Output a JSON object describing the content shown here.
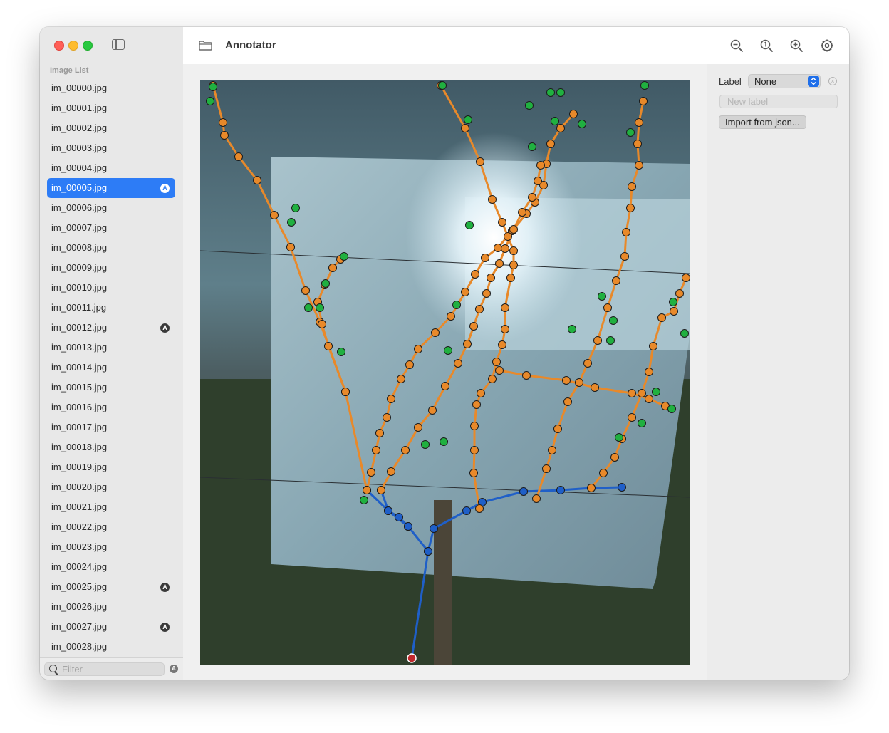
{
  "window": {
    "title": "Annotator"
  },
  "sidebar": {
    "section_header": "Image List",
    "items": [
      {
        "label": "im_00000.jpg",
        "annotated": false,
        "selected": false
      },
      {
        "label": "im_00001.jpg",
        "annotated": false,
        "selected": false
      },
      {
        "label": "im_00002.jpg",
        "annotated": false,
        "selected": false
      },
      {
        "label": "im_00003.jpg",
        "annotated": false,
        "selected": false
      },
      {
        "label": "im_00004.jpg",
        "annotated": false,
        "selected": false
      },
      {
        "label": "im_00005.jpg",
        "annotated": true,
        "selected": true
      },
      {
        "label": "im_00006.jpg",
        "annotated": false,
        "selected": false
      },
      {
        "label": "im_00007.jpg",
        "annotated": false,
        "selected": false
      },
      {
        "label": "im_00008.jpg",
        "annotated": false,
        "selected": false
      },
      {
        "label": "im_00009.jpg",
        "annotated": false,
        "selected": false
      },
      {
        "label": "im_00010.jpg",
        "annotated": false,
        "selected": false
      },
      {
        "label": "im_00011.jpg",
        "annotated": false,
        "selected": false
      },
      {
        "label": "im_00012.jpg",
        "annotated": true,
        "selected": false
      },
      {
        "label": "im_00013.jpg",
        "annotated": false,
        "selected": false
      },
      {
        "label": "im_00014.jpg",
        "annotated": false,
        "selected": false
      },
      {
        "label": "im_00015.jpg",
        "annotated": false,
        "selected": false
      },
      {
        "label": "im_00016.jpg",
        "annotated": false,
        "selected": false
      },
      {
        "label": "im_00017.jpg",
        "annotated": false,
        "selected": false
      },
      {
        "label": "im_00018.jpg",
        "annotated": false,
        "selected": false
      },
      {
        "label": "im_00019.jpg",
        "annotated": false,
        "selected": false
      },
      {
        "label": "im_00020.jpg",
        "annotated": false,
        "selected": false
      },
      {
        "label": "im_00021.jpg",
        "annotated": false,
        "selected": false
      },
      {
        "label": "im_00022.jpg",
        "annotated": false,
        "selected": false
      },
      {
        "label": "im_00023.jpg",
        "annotated": false,
        "selected": false
      },
      {
        "label": "im_00024.jpg",
        "annotated": false,
        "selected": false
      },
      {
        "label": "im_00025.jpg",
        "annotated": true,
        "selected": false
      },
      {
        "label": "im_00026.jpg",
        "annotated": false,
        "selected": false
      },
      {
        "label": "im_00027.jpg",
        "annotated": true,
        "selected": false
      },
      {
        "label": "im_00028.jpg",
        "annotated": false,
        "selected": false
      }
    ],
    "badge_letter": "A",
    "filter_placeholder": "Filter"
  },
  "toolbar": {
    "icons": [
      "folder-icon",
      "zoom-out-icon",
      "actual-size-icon",
      "zoom-in-icon",
      "settings-icon"
    ]
  },
  "inspector": {
    "label_title": "Label",
    "label_value": "None",
    "new_label_placeholder": "New label",
    "import_button": "Import from json..."
  },
  "colors": {
    "accent": "#2d7cf6",
    "trunk": "#1f5fc8",
    "branch": "#e8892a",
    "leaf": "#20b040",
    "root": "#c0282c"
  }
}
